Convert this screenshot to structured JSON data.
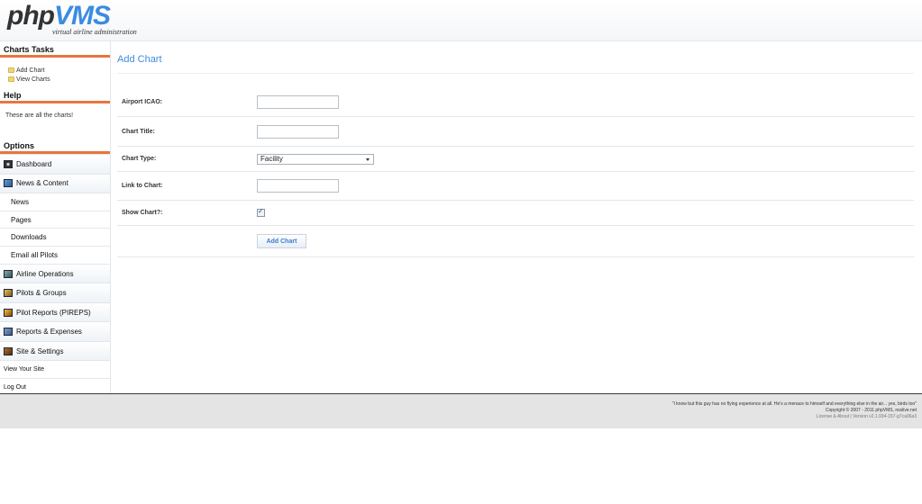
{
  "header": {
    "logo_php": "php",
    "logo_vms": "VMS",
    "tagline": "virtual airline administration"
  },
  "sidebar": {
    "tasks_title": "Charts Tasks",
    "tasks": [
      {
        "label": "Add Chart",
        "icon": "folder-icon"
      },
      {
        "label": "View Charts",
        "icon": "folder-icon"
      }
    ],
    "help_title": "Help",
    "help_text": "These are all the charts!",
    "options_title": "Options",
    "nav": {
      "dashboard": "Dashboard",
      "news_content": "News & Content",
      "news": "News",
      "pages": "Pages",
      "downloads": "Downloads",
      "email_pilots": "Email all Pilots",
      "airline_ops": "Airline Operations",
      "pilots_groups": "Pilots & Groups",
      "pireps": "Pilot Reports (PIREPS)",
      "reports_expenses": "Reports & Expenses",
      "site_settings": "Site & Settings",
      "view_site": "View Your Site",
      "log_out": "Log Out"
    }
  },
  "main": {
    "title": "Add Chart",
    "form": {
      "airport_icao_label": "Airport ICAO:",
      "airport_icao_value": "",
      "chart_title_label": "Chart Title:",
      "chart_title_value": "",
      "chart_type_label": "Chart Type:",
      "chart_type_value": "Facility",
      "link_label": "Link to Chart:",
      "link_value": "",
      "show_chart_label": "Show Chart?:",
      "show_chart_checked": true,
      "submit_label": "Add Chart"
    }
  },
  "footer": {
    "quote": "\"I know but this guy has no flying experience at all. He's a menace to himself and everything else in the air... yes, birds too\"",
    "copyright": "Copyright © 2007 - 2011 phpVMS, nsslive.net",
    "license": "License & About | Version v2.1.934-157-g7ca06a3"
  },
  "colors": {
    "accent": "#3b8be0",
    "section_rule": "#e8753d",
    "footer_bg": "#e4e4e4"
  }
}
